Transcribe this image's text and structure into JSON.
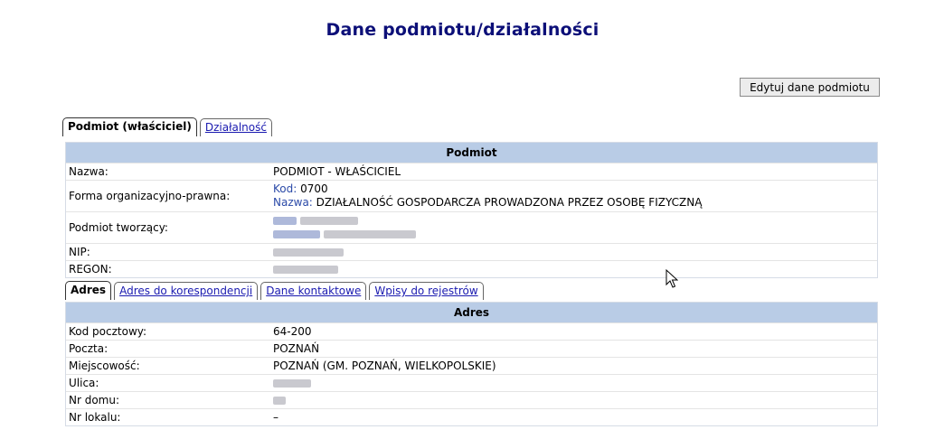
{
  "page": {
    "title": "Dane podmiotu/działalności"
  },
  "actions": {
    "edit_label": "Edytuj dane podmiotu"
  },
  "top_tabs": [
    {
      "label": "Podmiot (właściciel)",
      "active": true
    },
    {
      "label": "Działalność",
      "active": false
    }
  ],
  "podmiot": {
    "header": "Podmiot",
    "nazwa_label": "Nazwa:",
    "nazwa_value": "PODMIOT - WŁAŚCICIEL",
    "forma_label": "Forma organizacyjno-prawna:",
    "forma_kod_label": "Kod:",
    "forma_kod_value": "0700",
    "forma_nazwa_label": "Nazwa:",
    "forma_nazwa_value": "DZIAŁALNOŚĆ GOSPODARCZA PROWADZONA PRZEZ OSOBĘ FIZYCZNĄ",
    "tworzacy_label": "Podmiot tworzący:",
    "nip_label": "NIP:",
    "regon_label": "REGON:"
  },
  "address_tabs": [
    {
      "label": "Adres",
      "active": true
    },
    {
      "label": "Adres do korespondencji",
      "active": false
    },
    {
      "label": "Dane kontaktowe",
      "active": false
    },
    {
      "label": "Wpisy do rejestrów",
      "active": false
    }
  ],
  "adres": {
    "header": "Adres",
    "kod_label": "Kod pocztowy:",
    "kod_value": "64-200",
    "poczta_label": "Poczta:",
    "poczta_value": "POZNAŃ",
    "miejscowosc_label": "Miejscowość:",
    "miejscowosc_value": "POZNAŃ (GM. POZNAŃ, WIELKOPOLSKIE)",
    "ulica_label": "Ulica:",
    "nr_domu_label": "Nr domu:",
    "nr_lokalu_label": "Nr lokalu:",
    "nr_lokalu_value": "–"
  }
}
